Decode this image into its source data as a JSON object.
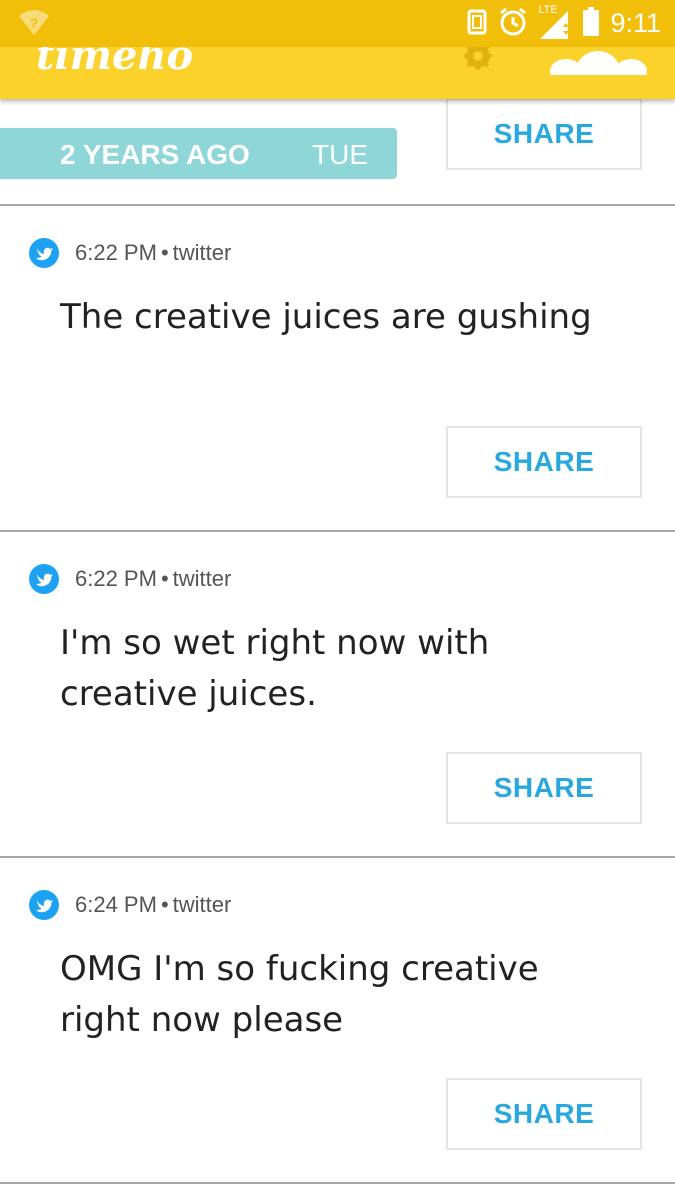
{
  "status_bar": {
    "network_type": "LTE",
    "time": "9:11"
  },
  "app_bar": {
    "logo_text": "timehop"
  },
  "date_header": {
    "ago": "2 YEARS AGO",
    "day": "TUE",
    "share_label": "SHARE"
  },
  "posts": [
    {
      "time": "6:22 PM",
      "source": "twitter",
      "text": "The creative juices are gushing",
      "share_label": "SHARE"
    },
    {
      "time": "6:22 PM",
      "source": "twitter",
      "text": "I'm so wet right now with creative juices.",
      "share_label": "SHARE"
    },
    {
      "time": "6:24 PM",
      "source": "twitter",
      "text": "OMG I'm so fucking creative right now please",
      "share_label": "SHARE"
    }
  ],
  "colors": {
    "status_bar": "#f1bf0a",
    "app_bar": "#fbd22b",
    "date_pill": "#8fd6d8",
    "share_text": "#29a8e0",
    "twitter_blue": "#1da1f2"
  }
}
